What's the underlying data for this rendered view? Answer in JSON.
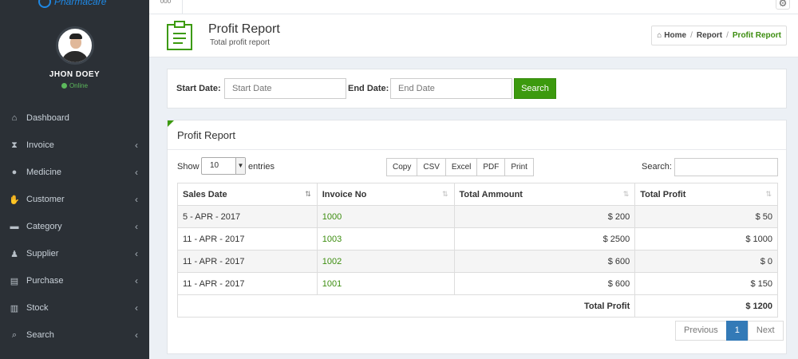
{
  "brand": {
    "name": "Pharmacare"
  },
  "user": {
    "name": "JHON DOEY",
    "status": "Online"
  },
  "sidebar": {
    "items": [
      {
        "label": "Dashboard",
        "icon": "home-icon",
        "glyph": "⌂",
        "has_children": false
      },
      {
        "label": "Invoice",
        "icon": "hourglass-icon",
        "glyph": "⧗",
        "has_children": true
      },
      {
        "label": "Medicine",
        "icon": "pill-icon",
        "glyph": "●",
        "has_children": true
      },
      {
        "label": "Customer",
        "icon": "handshake-icon",
        "glyph": "✋",
        "has_children": true
      },
      {
        "label": "Category",
        "icon": "cart-icon",
        "glyph": "▬",
        "has_children": true
      },
      {
        "label": "Supplier",
        "icon": "person-icon",
        "glyph": "♟",
        "has_children": true
      },
      {
        "label": "Purchase",
        "icon": "document-icon",
        "glyph": "▤",
        "has_children": true
      },
      {
        "label": "Stock",
        "icon": "bar-chart-icon",
        "glyph": "▥",
        "has_children": true
      },
      {
        "label": "Search",
        "icon": "search-icon",
        "glyph": "⌕",
        "has_children": true
      }
    ]
  },
  "topbar": {
    "tab_label": "000"
  },
  "page": {
    "title": "Profit Report",
    "subtitle": "Total profit report",
    "breadcrumb": {
      "home": "Home",
      "middle": "Report",
      "current": "Profit Report"
    }
  },
  "filter": {
    "start_label": "Start Date:",
    "start_placeholder": "Start Date",
    "end_label": "End Date:",
    "end_placeholder": "End Date",
    "search_button": "Search"
  },
  "report": {
    "panel_title": "Profit Report",
    "show_label": "Show",
    "entries_value": "10",
    "entries_label": "entries",
    "export_buttons": [
      "Copy",
      "CSV",
      "Excel",
      "PDF",
      "Print"
    ],
    "search_label": "Search:",
    "columns": [
      "Sales Date",
      "Invoice No",
      "Total Ammount",
      "Total Profit"
    ],
    "rows": [
      {
        "date": "5 - APR - 2017",
        "invoice": "1000",
        "amount": "$ 200",
        "profit": "$ 50"
      },
      {
        "date": "11 - APR - 2017",
        "invoice": "1003",
        "amount": "$ 2500",
        "profit": "$ 1000"
      },
      {
        "date": "11 - APR - 2017",
        "invoice": "1002",
        "amount": "$ 600",
        "profit": "$ 0"
      },
      {
        "date": "11 - APR - 2017",
        "invoice": "1001",
        "amount": "$ 600",
        "profit": "$ 150"
      }
    ],
    "total_label": "Total Profit",
    "total_value": "$ 1200",
    "pagination": {
      "previous": "Previous",
      "current_page": "1",
      "next": "Next"
    }
  },
  "colors": {
    "accent": "#3c9a0e",
    "sidebar_bg": "#2b3036",
    "pager_active": "#337ab7",
    "link": "#3c8d0f"
  }
}
